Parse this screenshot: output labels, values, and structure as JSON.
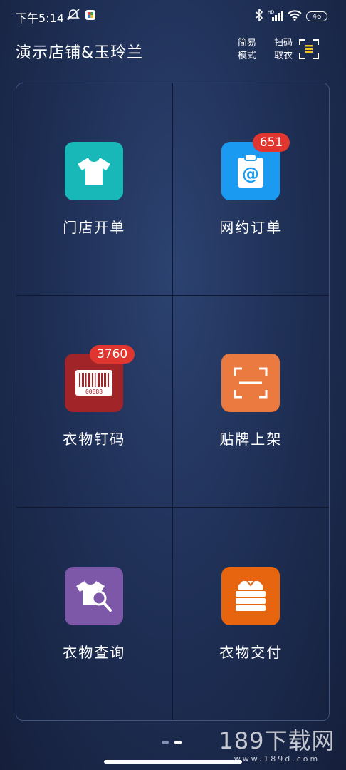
{
  "status_bar": {
    "time": "下午5:14",
    "battery": "46"
  },
  "header": {
    "title": "演示店铺&玉玲兰",
    "simple_mode_line1": "简易",
    "simple_mode_line2": "模式",
    "scan_pickup_line1": "扫码",
    "scan_pickup_line2": "取衣"
  },
  "tiles": [
    {
      "label": "门店开单",
      "icon": "tshirt-icon",
      "color": "#18b8b8",
      "badge": ""
    },
    {
      "label": "网约订单",
      "icon": "clipboard-at-icon",
      "color": "#1a9af0",
      "badge": "651"
    },
    {
      "label": "衣物钉码",
      "icon": "barcode-tag-icon",
      "color": "#a02428",
      "badge": "3760"
    },
    {
      "label": "贴牌上架",
      "icon": "scan-frame-icon",
      "color": "#ea7a3f",
      "badge": ""
    },
    {
      "label": "衣物查询",
      "icon": "shirt-search-icon",
      "color": "#7e58a8",
      "badge": ""
    },
    {
      "label": "衣物交付",
      "icon": "folded-clothes-icon",
      "color": "#e8650f",
      "badge": ""
    }
  ],
  "barcode_text": "00888",
  "watermark": {
    "main": "189下载网",
    "sub": "www.189d.com"
  }
}
